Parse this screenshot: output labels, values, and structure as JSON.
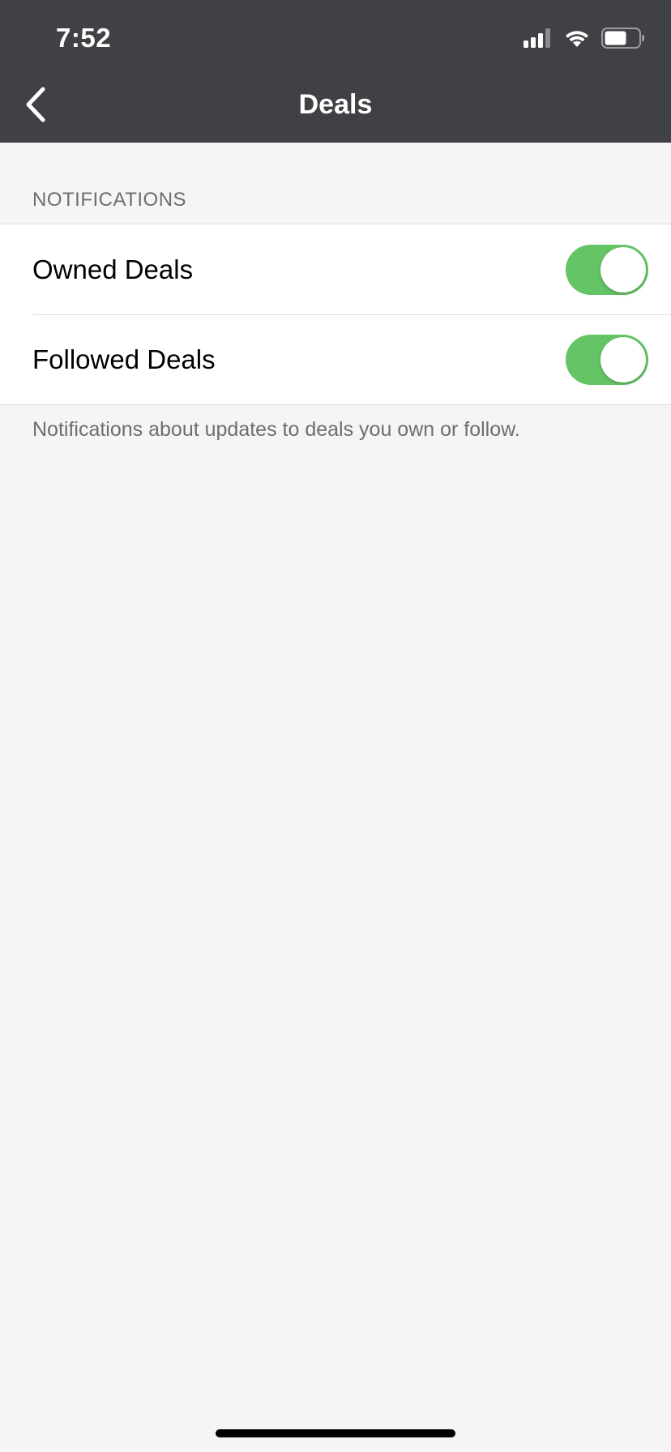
{
  "status_bar": {
    "time": "7:52",
    "icons": [
      "signal-icon",
      "wifi-icon",
      "battery-icon"
    ]
  },
  "nav": {
    "title": "Deals",
    "back_icon": "chevron-left-icon"
  },
  "notifications": {
    "header": "NOTIFICATIONS",
    "items": [
      {
        "label": "Owned Deals",
        "enabled": true
      },
      {
        "label": "Followed Deals",
        "enabled": true
      }
    ],
    "footer": "Notifications about updates to deals you own or follow."
  },
  "colors": {
    "nav_background": "#404144",
    "toggle_on": "#65c466",
    "page_background": "#f5f5f5"
  }
}
